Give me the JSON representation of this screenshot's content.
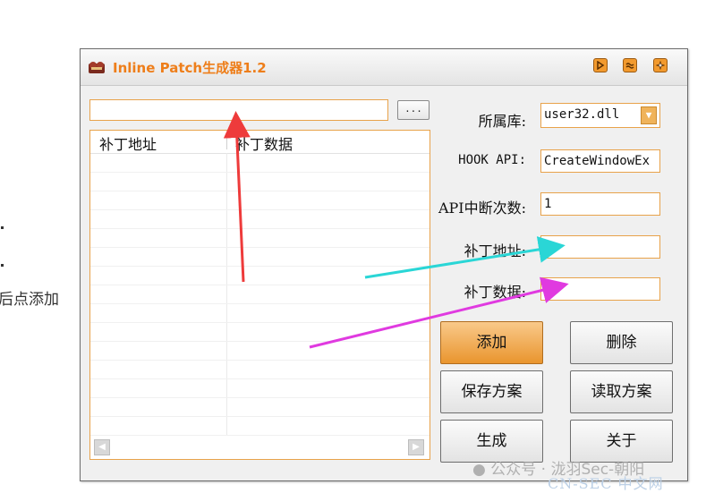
{
  "background": {
    "left_note": "后点添加"
  },
  "window": {
    "title": "Inline Patch生成器1.2",
    "path": {
      "value": ""
    },
    "browse_label": "...",
    "list": {
      "columns": [
        "补丁地址",
        "补丁数据"
      ],
      "rows": []
    },
    "form": {
      "module_label": "所属库:",
      "module_value": "user32.dll",
      "hook_api_label": "HOOK API:",
      "hook_api_value": "CreateWindowEx",
      "break_count_label": "API中断次数:",
      "break_count_value": "1",
      "patch_addr_label": "补丁地址:",
      "patch_addr_value": "",
      "patch_data_label": "补丁数据:",
      "patch_data_value": ""
    },
    "buttons": {
      "add": "添加",
      "delete": "删除",
      "save": "保存方案",
      "load": "读取方案",
      "generate": "生成",
      "about": "关于"
    }
  },
  "watermark": {
    "text": "公众号 · 泷羽Sec-朝阳",
    "sub": "CN-SEC 中文网"
  },
  "colors": {
    "accent": "#ee7e1a",
    "field_border": "#e8a24a",
    "arrow_red": "#ee3b3b",
    "arrow_cyan": "#2ad6d6",
    "arrow_magenta": "#e03ae0"
  }
}
